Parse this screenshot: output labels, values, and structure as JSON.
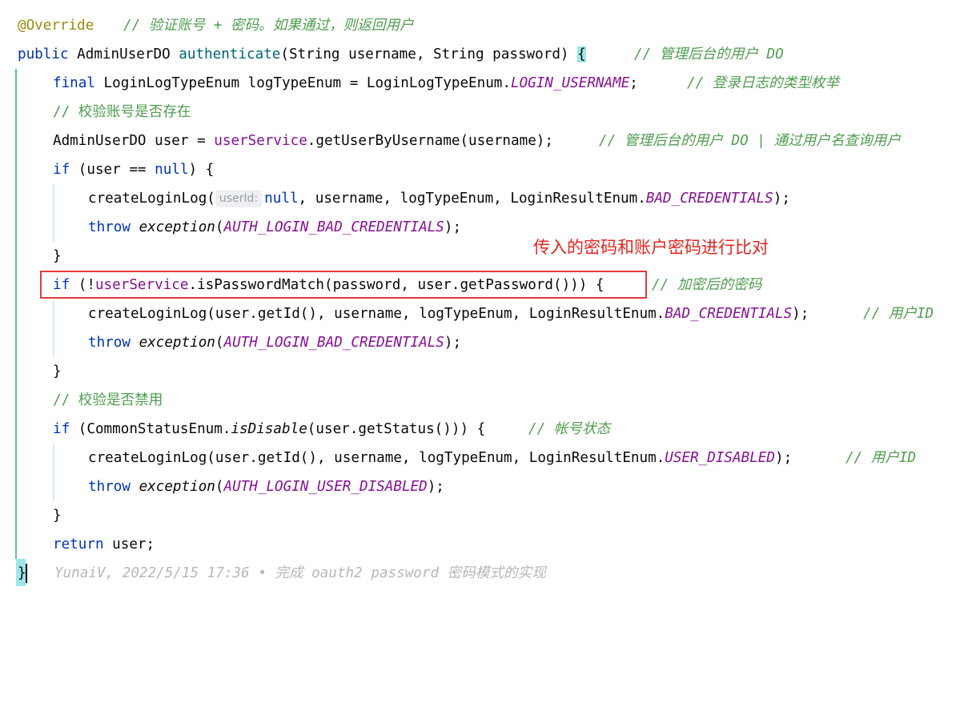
{
  "lines": {
    "l1": {
      "annotation": "@Override",
      "comment": "// 验证账号 + 密码。如果通过，则返回用户"
    },
    "l2": {
      "kw_public": "public",
      "text1": " AdminUserDO ",
      "method": "authenticate",
      "text2": "(String username, String password) ",
      "brace": "{",
      "comment": "// 管理后台的用户 DO"
    },
    "l3": {
      "kw_final": "final",
      "text1": " LoginLogTypeEnum logTypeEnum = LoginLogTypeEnum.",
      "const": "LOGIN_USERNAME",
      "text2": ";",
      "comment": "// 登录日志的类型枚举"
    },
    "l4": {
      "comment": "// 校验账号是否存在"
    },
    "l5": {
      "text1": "AdminUserDO user = ",
      "field": "userService",
      "text2": ".getUserByUsername(username);",
      "comment": "// 管理后台的用户 DO | 通过用户名查询用户"
    },
    "l6": {
      "kw_if": "if",
      "text1": " (user == ",
      "kw_null": "null",
      "text2": ") {"
    },
    "l7": {
      "text1": "createLoginLog(",
      "hint": "userId:",
      "kw_null": "null",
      "text2": ", username, logTypeEnum, LoginResultEnum.",
      "const": "BAD_CREDENTIALS",
      "text3": ");"
    },
    "l8": {
      "kw_throw": "throw",
      "method": "exception",
      "text1": "(",
      "const": "AUTH_LOGIN_BAD_CREDENTIALS",
      "text2": ");"
    },
    "l9": {
      "text1": "}"
    },
    "l10": {
      "kw_if": "if",
      "text1": " (!",
      "field": "userService",
      "text2": ".isPasswordMatch(password, user.getPassword())) {",
      "comment": "// 加密后的密码"
    },
    "l11": {
      "text1": "createLoginLog(user.getId(), username, logTypeEnum, LoginResultEnum.",
      "const": "BAD_CREDENTIALS",
      "text2": ");",
      "comment": "// 用户ID"
    },
    "l12": {
      "kw_throw": "throw",
      "method": "exception",
      "text1": "(",
      "const": "AUTH_LOGIN_BAD_CREDENTIALS",
      "text2": ");"
    },
    "l13": {
      "text1": "}"
    },
    "l14": {
      "comment": "// 校验是否禁用"
    },
    "l15": {
      "kw_if": "if",
      "text1": " (CommonStatusEnum.",
      "method": "isDisable",
      "text2": "(user.getStatus())) {",
      "comment": "// 帐号状态"
    },
    "l16": {
      "text1": "createLoginLog(user.getId(), username, logTypeEnum, LoginResultEnum.",
      "const": "USER_DISABLED",
      "text2": ");",
      "comment": "// 用户ID"
    },
    "l17": {
      "kw_throw": "throw",
      "method": "exception",
      "text1": "(",
      "const": "AUTH_LOGIN_USER_DISABLED",
      "text2": ");"
    },
    "l18": {
      "text1": "}"
    },
    "l19": {
      "kw_return": "return",
      "text1": " user;"
    },
    "l20": {
      "brace": "}",
      "blame": "YunaiV, 2022/5/15 17:36 • 完成 oauth2 password 密码模式的实现"
    }
  },
  "annotation_note": "传入的密码和账户密码进行比对",
  "colors": {
    "keyword": "#0033b3",
    "field": "#871094",
    "annotation": "#9e880d",
    "comment": "#8c8c8c",
    "note": "#e3251f",
    "box": "#e43b3b"
  }
}
